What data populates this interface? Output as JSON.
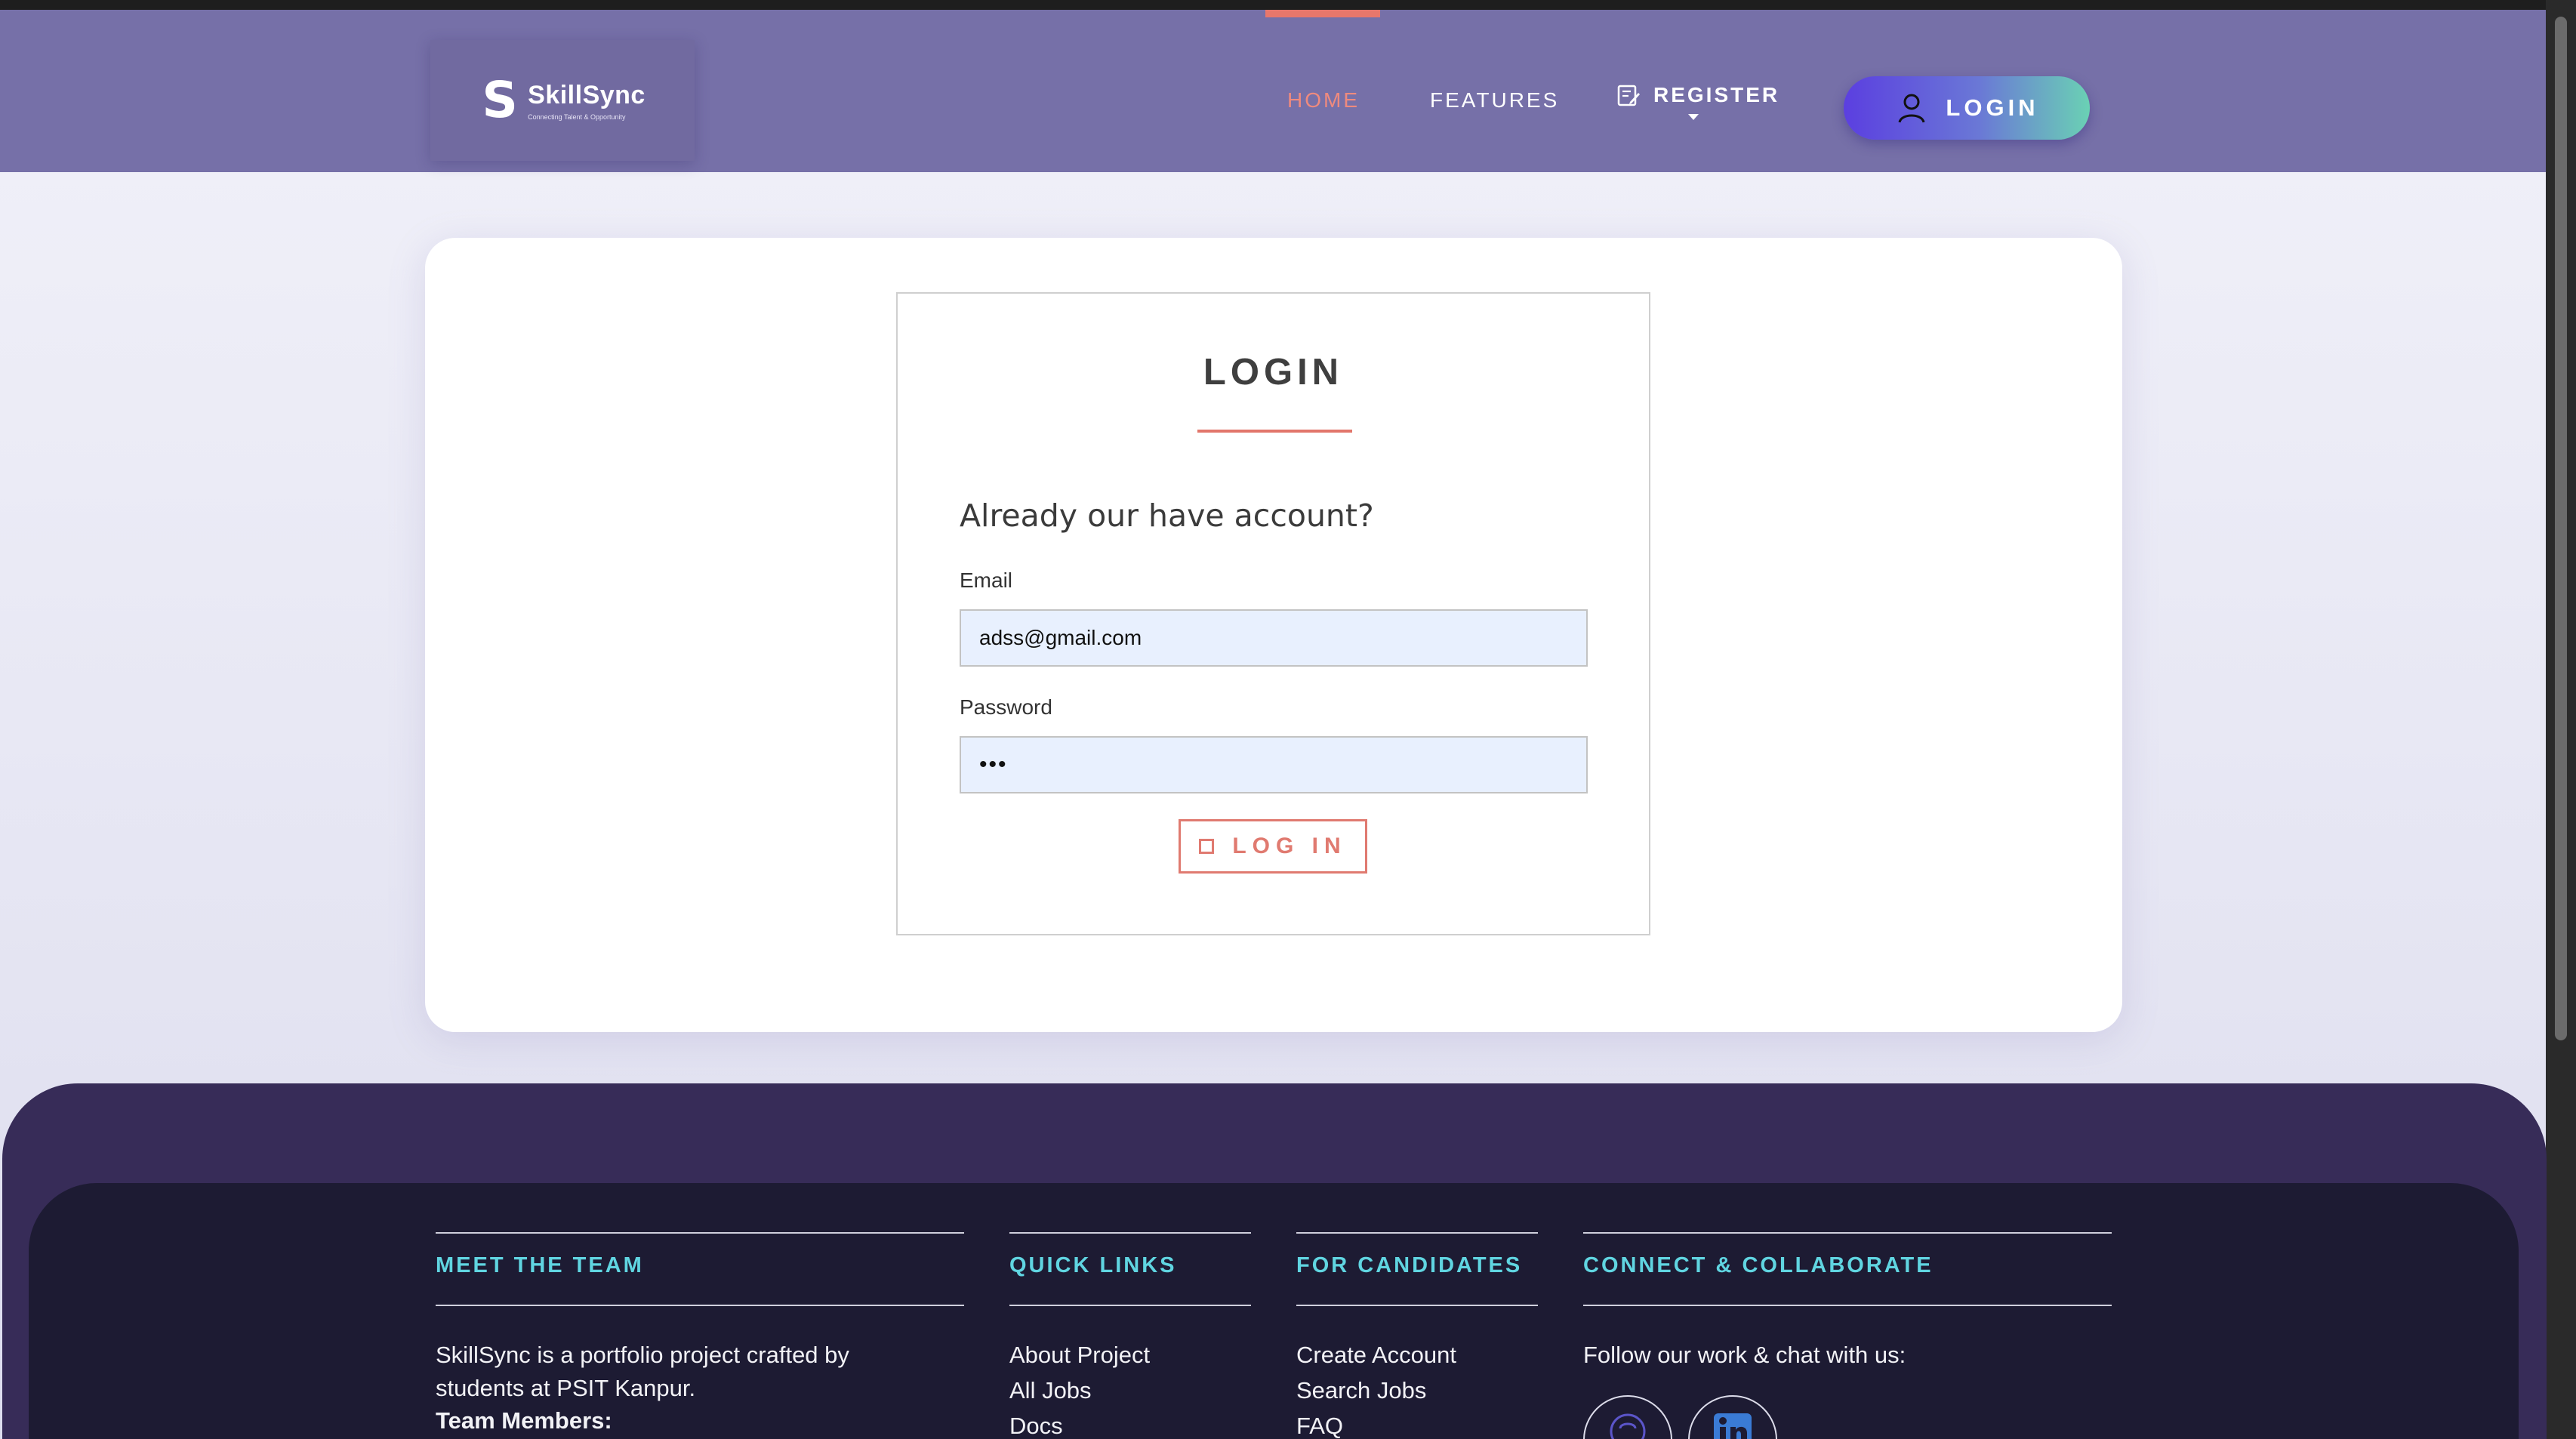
{
  "nav": {
    "logo": {
      "name": "SkillSync",
      "tagline": "Connecting Talent & Opportunity"
    },
    "links": {
      "home": "HOME",
      "features": "FEATURES",
      "register": "REGISTER"
    },
    "login_button": "LOGIN"
  },
  "login": {
    "title": "LOGIN",
    "subtitle": "Already our have account?",
    "email_label": "Email",
    "email_value": "adss@gmail.com",
    "password_label": "Password",
    "password_value": "•••",
    "submit_label": "LOG IN"
  },
  "footer": {
    "team": {
      "title": "MEET THE TEAM",
      "text_1": "SkillSync is a portfolio project crafted by",
      "text_2": "students at PSIT Kanpur.",
      "members_label": "Team Members:"
    },
    "quick_links": {
      "title": "QUICK LINKS",
      "items": [
        "About Project",
        "All Jobs",
        "Docs"
      ]
    },
    "candidates": {
      "title": "FOR CANDIDATES",
      "items": [
        "Create Account",
        "Search Jobs",
        "FAQ"
      ]
    },
    "connect": {
      "title": "CONNECT & COLLABORATE",
      "text": "Follow our work & chat with us:"
    }
  },
  "colors": {
    "nav_bg": "#7670a8",
    "accent": "#e2766b",
    "footer_heading": "#60d5e1",
    "footer_bg": "#1d1b33"
  }
}
